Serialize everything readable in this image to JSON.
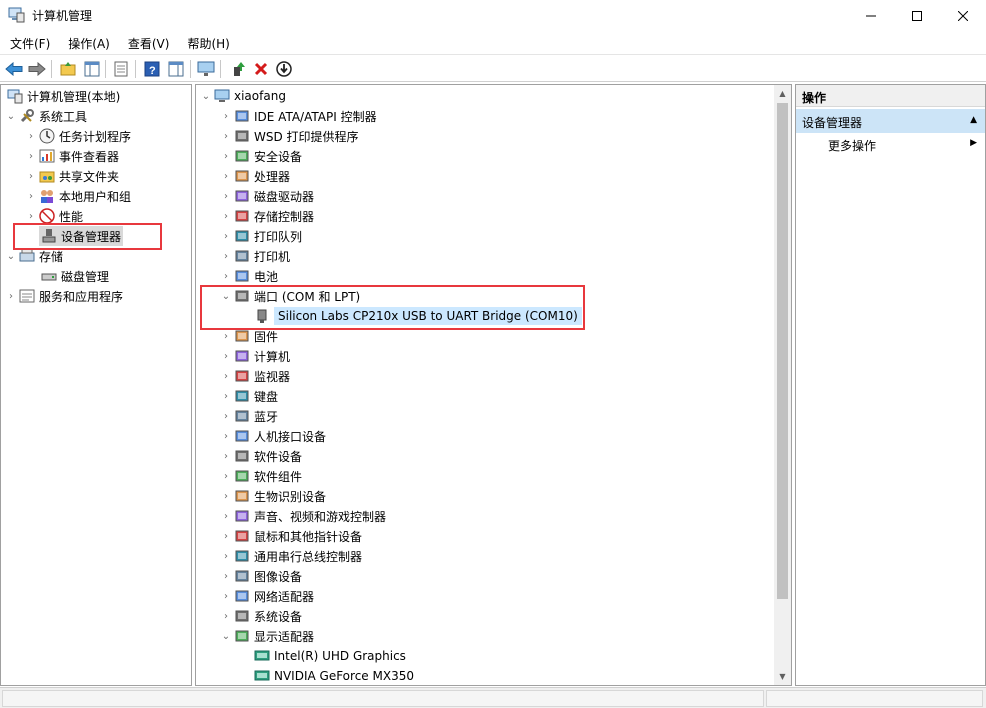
{
  "window": {
    "title": "计算机管理"
  },
  "menu": [
    "文件(F)",
    "操作(A)",
    "查看(V)",
    "帮助(H)"
  ],
  "left_tree": {
    "root": "计算机管理(本地)",
    "system_tools": "系统工具",
    "items": [
      "任务计划程序",
      "事件查看器",
      "共享文件夹",
      "本地用户和组",
      "性能",
      "设备管理器"
    ],
    "storage": "存储",
    "disk_mgmt": "磁盘管理",
    "services": "服务和应用程序"
  },
  "device_tree": {
    "computer": "xiaofang",
    "categories": [
      "IDE ATA/ATAPI 控制器",
      "WSD 打印提供程序",
      "安全设备",
      "处理器",
      "磁盘驱动器",
      "存储控制器",
      "打印队列",
      "打印机",
      "电池",
      "端口 (COM 和 LPT)"
    ],
    "port_child": "Silicon Labs CP210x USB to UART Bridge (COM10)",
    "categories2": [
      "固件",
      "计算机",
      "监视器",
      "键盘",
      "蓝牙",
      "人机接口设备",
      "软件设备",
      "软件组件",
      "生物识别设备",
      "声音、视频和游戏控制器",
      "鼠标和其他指针设备",
      "通用串行总线控制器",
      "图像设备",
      "网络适配器",
      "系统设备",
      "显示适配器"
    ],
    "display_children": [
      "Intel(R) UHD Graphics",
      "NVIDIA GeForce MX350"
    ]
  },
  "actions": {
    "header": "操作",
    "section": "设备管理器",
    "more": "更多操作"
  }
}
